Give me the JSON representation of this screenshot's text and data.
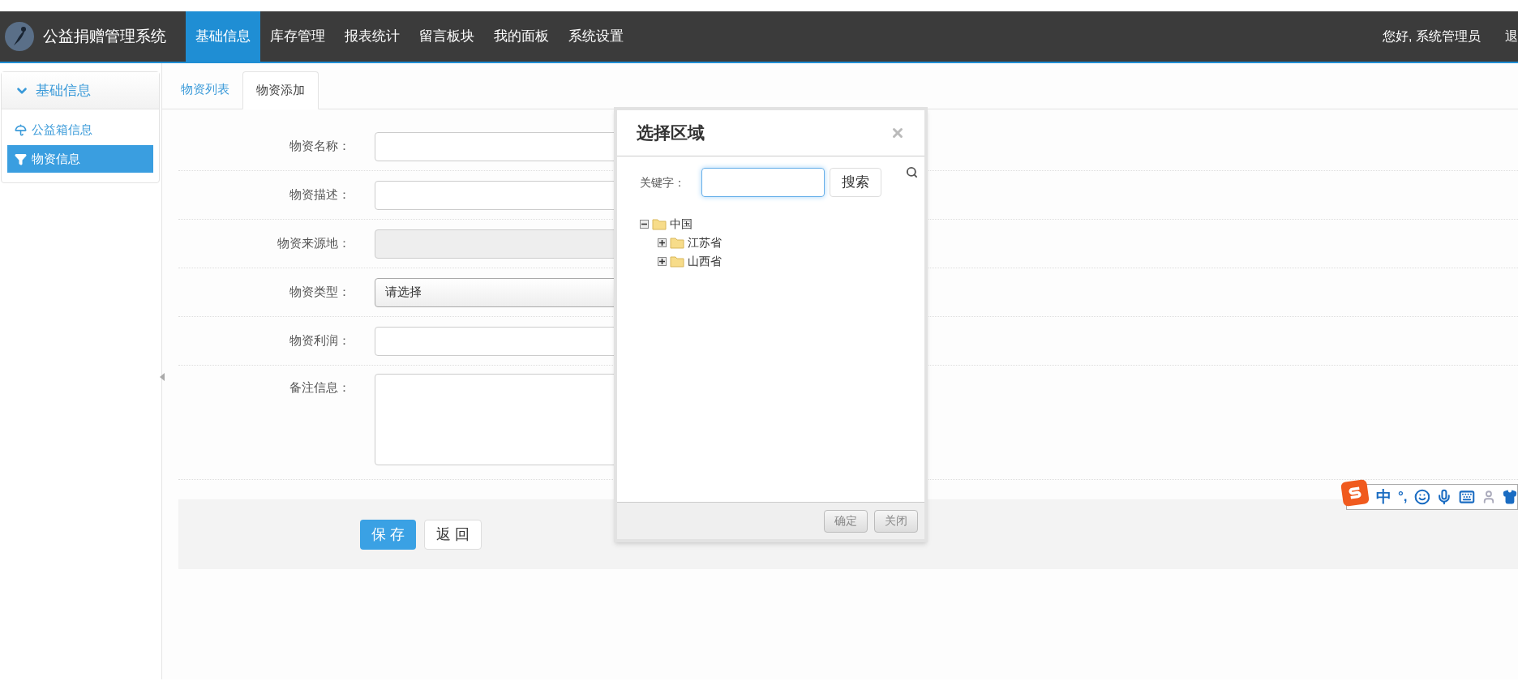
{
  "header": {
    "app_title": "公益捐赠管理系统",
    "nav": [
      {
        "label": "基础信息",
        "selected": true
      },
      {
        "label": "库存管理",
        "selected": false
      },
      {
        "label": "报表统计",
        "selected": false
      },
      {
        "label": "留言板块",
        "selected": false
      },
      {
        "label": "我的面板",
        "selected": false
      },
      {
        "label": "系统设置",
        "selected": false
      }
    ],
    "greeting": "您好, 系统管理员",
    "logout": "退"
  },
  "sidebar": {
    "section": {
      "title": "基础信息",
      "expanded": true
    },
    "items": [
      {
        "label": "公益箱信息",
        "selected": false
      },
      {
        "label": "物资信息",
        "selected": true
      }
    ]
  },
  "tabs": [
    {
      "label": "物资列表",
      "selected": false
    },
    {
      "label": "物资添加",
      "selected": true
    }
  ],
  "form": {
    "fields": [
      {
        "label": "物资名称：",
        "kind": "text"
      },
      {
        "label": "物资描述：",
        "kind": "text"
      },
      {
        "label": "物资来源地：",
        "kind": "lookup"
      },
      {
        "label": "物资类型：",
        "kind": "select",
        "value": "请选择"
      },
      {
        "label": "物资利润：",
        "kind": "text"
      },
      {
        "label": "备注信息：",
        "kind": "textarea"
      }
    ],
    "buttons": [
      {
        "label": "保 存",
        "kind": "primary"
      },
      {
        "label": "返 回",
        "kind": "default"
      }
    ]
  },
  "dialog": {
    "title": "选择区域",
    "keyword_label": "关键字：",
    "keyword_focused": true,
    "search_button": "搜索",
    "tree": [
      {
        "label": "中国",
        "expanded": true,
        "children": [
          {
            "label": "江苏省",
            "expanded": false
          },
          {
            "label": "山西省",
            "expanded": false
          }
        ]
      }
    ],
    "buttons": [
      "确定",
      "关闭"
    ]
  },
  "ime_bar": {
    "mode": "中",
    "punctuation": "°,"
  }
}
